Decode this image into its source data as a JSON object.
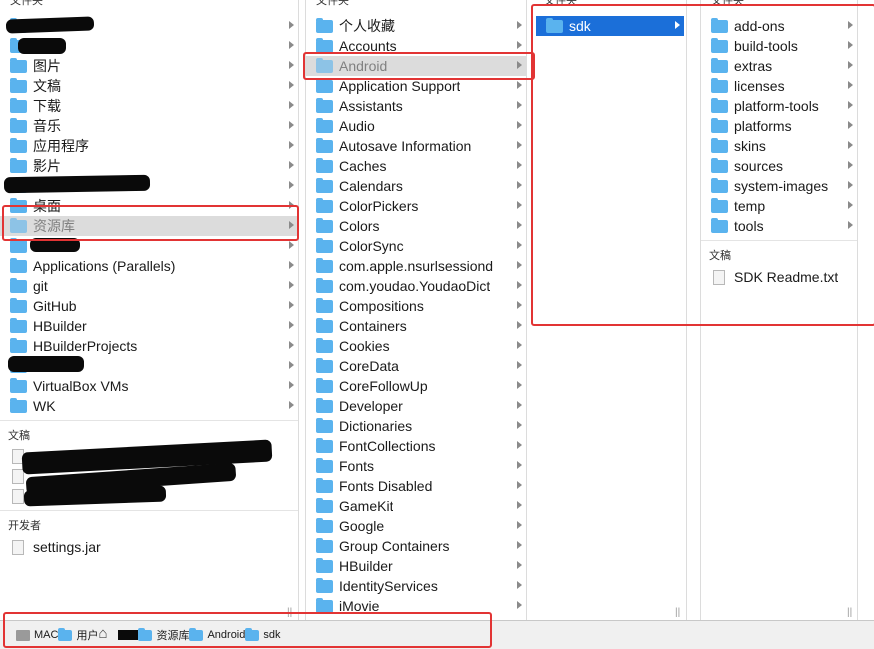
{
  "col1": {
    "header": "文件夹",
    "items": [
      {
        "label": "图片",
        "icon": "folder-icon"
      },
      {
        "label": "文稿",
        "icon": "folder-icon"
      },
      {
        "label": "下载",
        "icon": "folder-icon"
      },
      {
        "label": "音乐",
        "icon": "folder-icon"
      },
      {
        "label": "应用程序",
        "icon": "folder-icon"
      },
      {
        "label": "影片",
        "icon": "folder-icon"
      },
      {
        "label": "桌面",
        "icon": "folder-icon"
      },
      {
        "label": "资源库",
        "icon": "folder-icon"
      },
      {
        "label": "Applications (Parallels)",
        "icon": "folder-icon"
      },
      {
        "label": "git",
        "icon": "folder-icon"
      },
      {
        "label": "GitHub",
        "icon": "folder-icon"
      },
      {
        "label": "HBuilder",
        "icon": "folder-icon"
      },
      {
        "label": "HBuilderProjects",
        "icon": "folder-icon"
      },
      {
        "label": "VirtualBox VMs",
        "icon": "folder-icon"
      },
      {
        "label": "WK",
        "icon": "folder-icon"
      }
    ],
    "docs_header": "文稿",
    "dev_header": "开发者",
    "dev_items": [
      {
        "label": "settings.jar",
        "icon": "jar-file-icon"
      }
    ]
  },
  "col2": {
    "header": "文件夹",
    "items": [
      "个人收藏",
      "Accounts",
      "Android",
      "Application Support",
      "Assistants",
      "Audio",
      "Autosave Information",
      "Caches",
      "Calendars",
      "ColorPickers",
      "Colors",
      "ColorSync",
      "com.apple.nsurlsessiond",
      "com.youdao.YoudaoDict",
      "Compositions",
      "Containers",
      "Cookies",
      "CoreData",
      "CoreFollowUp",
      "Developer",
      "Dictionaries",
      "FontCollections",
      "Fonts",
      "Fonts Disabled",
      "GameKit",
      "Google",
      "Group Containers",
      "HBuilder",
      "IdentityServices",
      "iMovie"
    ],
    "selected": "Android"
  },
  "col3": {
    "header": "文件夹",
    "items": [
      "sdk"
    ],
    "selected": "sdk"
  },
  "col4": {
    "header": "文件夹",
    "items": [
      "add-ons",
      "build-tools",
      "extras",
      "licenses",
      "platform-tools",
      "platforms",
      "skins",
      "sources",
      "system-images",
      "temp",
      "tools"
    ],
    "docs_header": "文稿",
    "files": [
      "SDK Readme.txt"
    ]
  },
  "pathbar": {
    "crumbs": [
      {
        "label": "MAC",
        "icon": "hard-drive-icon"
      },
      {
        "label": "用户",
        "icon": "folder-icon"
      },
      {
        "label": "",
        "icon": "home-icon"
      },
      {
        "label": "资源库",
        "icon": "folder-icon"
      },
      {
        "label": "Android",
        "icon": "folder-icon"
      },
      {
        "label": "sdk",
        "icon": "folder-icon"
      }
    ]
  },
  "colors": {
    "folder": "#5ab3ee",
    "selection_blue": "#1b6fd9",
    "selection_gray": "#dcdcdc",
    "highlight_red": "#e23434"
  }
}
